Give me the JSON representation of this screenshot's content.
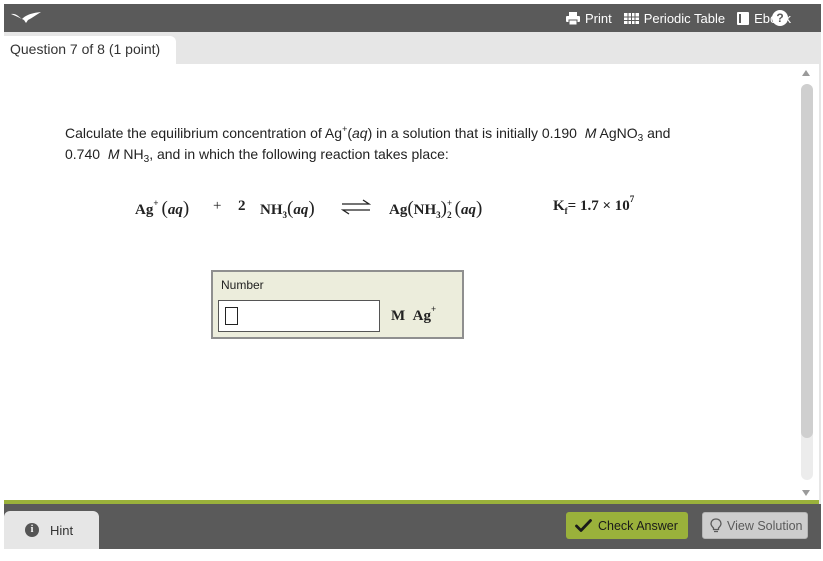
{
  "topbar": {
    "print_label": "Print",
    "periodic_table_label": "Periodic Table",
    "ebook_label": "Ebook",
    "help_label": "?"
  },
  "question_tab": {
    "label": "Question 7 of 8 (1 point)"
  },
  "question": {
    "p1": "Calculate the equilibrium concentration of Ag",
    "p1_sup": "+",
    "p1_aq": "aq",
    "p2": ") in a solution that is initially 0.190",
    "m1": "M",
    "p3": " AgNO",
    "p3_sub": "3",
    "p4": " and",
    "p5": "0.740",
    "m2": "M",
    "p6": " NH",
    "p6_sub": "3",
    "p7": ", and in which the following reaction takes place:"
  },
  "equation": {
    "ag": "Ag",
    "ag_charge": "+",
    "aq": "aq",
    "plus": "+",
    "coef": "2",
    "nh": "NH",
    "nh_sub": "3",
    "product_ag": "Ag",
    "product_nh": "NH",
    "product_nh_sub": "3",
    "product_charge": "+",
    "product_sub": "2",
    "k": "K",
    "k_sub": "f",
    "k_value": "= 1.7 × 10",
    "k_exp": "7"
  },
  "answer": {
    "label": "Number",
    "value": "",
    "unit": "M",
    "unit_species": "Ag",
    "unit_charge": "+"
  },
  "footer": {
    "hint_label": "Hint",
    "check_answer_label": "Check Answer",
    "view_solution_label": "View Solution"
  },
  "colors": {
    "topbar": "#5a5a5a",
    "accent_green": "#9ab13b",
    "answer_box": "#eceddc"
  },
  "icons": {
    "logo": "aleks-bird-logo-icon",
    "print": "printer-icon",
    "periodic_table": "table-grid-icon",
    "ebook": "book-icon",
    "help": "question-circle-icon",
    "hint": "info-circle-icon",
    "check": "checkmark-icon",
    "solution": "lightbulb-icon"
  }
}
